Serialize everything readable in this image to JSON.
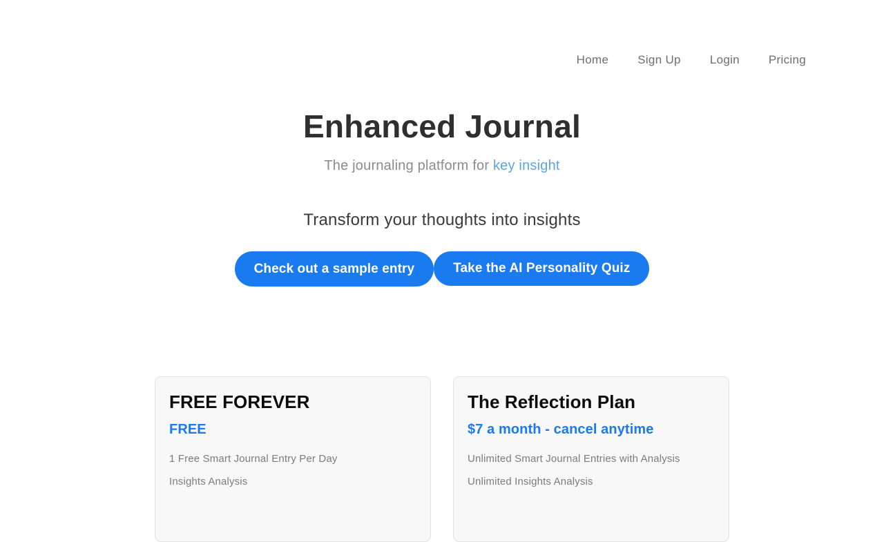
{
  "nav": {
    "items": [
      {
        "label": "Home"
      },
      {
        "label": "Sign Up"
      },
      {
        "label": "Login"
      },
      {
        "label": "Pricing"
      }
    ]
  },
  "hero": {
    "title": "Enhanced Journal",
    "subtitle_prefix": "The journaling platform for ",
    "subtitle_link": "key insight",
    "tagline": "Transform your thoughts into insights"
  },
  "cta": {
    "primary_label": "Check out a sample entry",
    "secondary_label": "Take the AI Personality Quiz"
  },
  "pricing": {
    "plans": [
      {
        "title": "FREE FOREVER",
        "price": "FREE",
        "features": [
          "1 Free Smart Journal Entry Per Day",
          "Insights Analysis"
        ]
      },
      {
        "title": "The Reflection Plan",
        "price": "$7 a month - cancel anytime",
        "features": [
          "Unlimited Smart Journal Entries with Analysis",
          "Unlimited Insights Analysis"
        ]
      }
    ]
  },
  "colors": {
    "accent_blue": "#1a7af0",
    "link_blue": "#5fa3e0",
    "page_background": "#ffffff",
    "card_background": "#f8f8f8",
    "card_border": "#e4e4e4",
    "title_text": "#2f2f2f",
    "muted_text": "#7c7c7c",
    "nav_text": "#6f6f6f"
  }
}
